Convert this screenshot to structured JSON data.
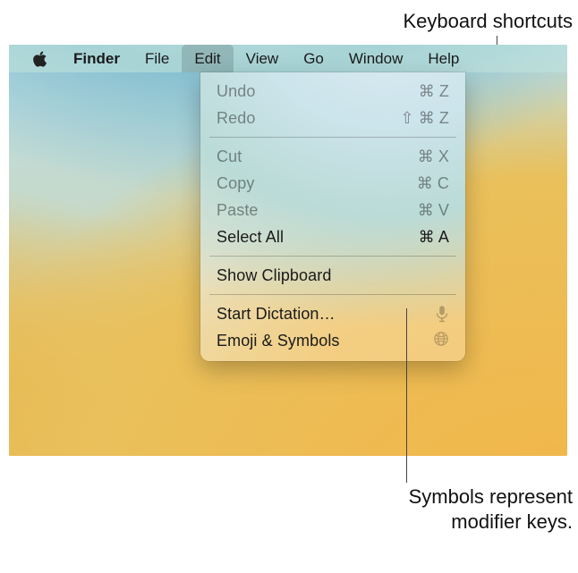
{
  "annotations": {
    "top": "Keyboard shortcuts",
    "bottom": "Symbols represent\nmodifier keys."
  },
  "menubar": {
    "app": "Finder",
    "items": {
      "file": "File",
      "edit": "Edit",
      "view": "View",
      "go": "Go",
      "window": "Window",
      "help": "Help"
    }
  },
  "menu": {
    "undo": {
      "label": "Undo",
      "shortcut": "⌘ Z"
    },
    "redo": {
      "label": "Redo",
      "shortcut": "⇧ ⌘ Z"
    },
    "cut": {
      "label": "Cut",
      "shortcut": "⌘ X"
    },
    "copy": {
      "label": "Copy",
      "shortcut": "⌘ C"
    },
    "paste": {
      "label": "Paste",
      "shortcut": "⌘ V"
    },
    "selectall": {
      "label": "Select All",
      "shortcut": "⌘ A"
    },
    "showclipboard": {
      "label": "Show Clipboard"
    },
    "dictation": {
      "label": "Start Dictation…"
    },
    "emoji": {
      "label": "Emoji & Symbols"
    }
  }
}
